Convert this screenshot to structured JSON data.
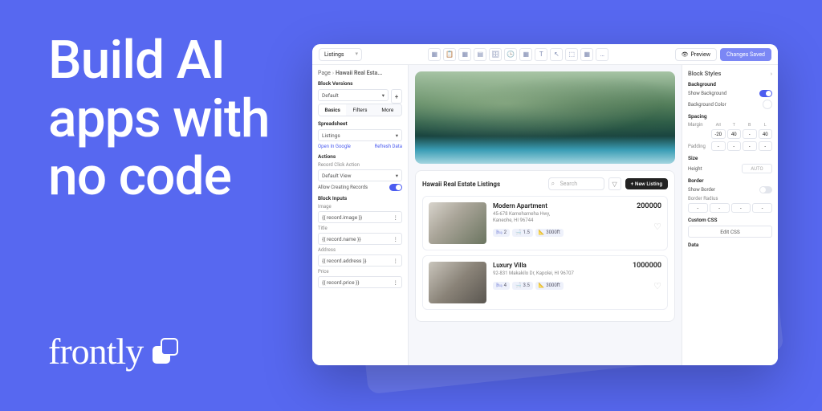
{
  "hero": {
    "headline": "Build AI\napps with\nno code"
  },
  "brand": {
    "name": "frontly"
  },
  "topbar": {
    "dropdown": "Listings",
    "preview": "Preview",
    "save_status": "Changes Saved",
    "tool_icons": [
      "▦",
      "📋",
      "▦",
      "▤",
      "🗄",
      "🕒",
      "▦",
      "T",
      "↖",
      "⬚",
      "▦",
      "…"
    ]
  },
  "left_panel": {
    "breadcrumb_root": "Page",
    "breadcrumb_current": "Hawaii Real Esta...",
    "block_versions_label": "Block Versions",
    "block_versions_value": "Default",
    "tabs": [
      "Basics",
      "Filters",
      "More"
    ],
    "spreadsheet_label": "Spreadsheet",
    "spreadsheet_value": "Listings",
    "open_in_google": "Open In Google",
    "refresh_data": "Refresh Data",
    "actions_label": "Actions",
    "record_click_label": "Record Click Action",
    "record_click_value": "Default View",
    "allow_create_label": "Allow Creating Records",
    "block_inputs_label": "Block Inputs",
    "image_label": "Image",
    "image_value": "{{ record.image }}",
    "title_label": "Title",
    "title_value": "{{ record.name }}",
    "address_label": "Address",
    "address_value": "{{ record.address }}",
    "price_label": "Price",
    "price_value": "{{ record.price }}"
  },
  "listings": {
    "title": "Hawaii Real Estate Listings",
    "search_placeholder": "Search",
    "new_button": "New Listing",
    "items": [
      {
        "title": "Modern Apartment",
        "address": "45-678 Kamehameha Hwy,\nKaneohe, HI 96744",
        "price": "200000",
        "beds": "2",
        "baths": "1.5",
        "size": "3000ft"
      },
      {
        "title": "Luxury Villa",
        "address": "92-831 Makakilo Dr, Kapolei, HI 96707",
        "price": "1000000",
        "beds": "4",
        "baths": "3.5",
        "size": "3000ft"
      }
    ]
  },
  "right_panel": {
    "title": "Block Styles",
    "background_label": "Background",
    "show_bg_label": "Show Background",
    "bg_color_label": "Background Color",
    "spacing_label": "Spacing",
    "margin_label": "Margin",
    "padding_label": "Padding",
    "cols": [
      "All",
      "T",
      "R",
      "B",
      "L"
    ],
    "margin_values": [
      "-20",
      "40",
      "-",
      "40"
    ],
    "padding_values": [
      "-",
      "-",
      "-",
      "-"
    ],
    "size_label": "Size",
    "height_label": "Height",
    "height_value": "AUTO",
    "border_label": "Border",
    "show_border_label": "Show Border",
    "radius_label": "Border Radius",
    "radius_values": [
      "-",
      "-",
      "-",
      "-"
    ],
    "custom_css_label": "Custom CSS",
    "edit_css_button": "Edit CSS",
    "data_label": "Data"
  }
}
